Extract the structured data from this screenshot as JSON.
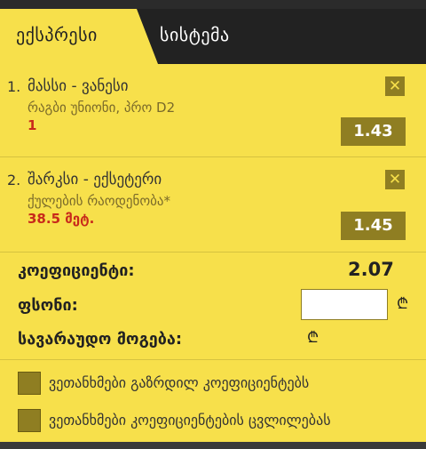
{
  "tabs": {
    "express": "ექსპრესი",
    "system": "სისტემა"
  },
  "bets": [
    {
      "index": "1.",
      "match": "მასსი - ვანესი",
      "market": "რაგბი უნიონი, პრო D2",
      "pick": "1",
      "odds": "1.43",
      "close": "✕"
    },
    {
      "index": "2.",
      "match": "შარკსი - ექსეტერი",
      "market": "ქულების რაოდენობა*",
      "pick": "38.5 მეტ.",
      "odds": "1.45",
      "close": "✕"
    }
  ],
  "summary": {
    "coef_label": "კოეფიციენტი:",
    "coef_value": "2.07",
    "stake_label": "ფსონი:",
    "stake_value": "",
    "win_label": "სავარაუდო მოგება:",
    "currency": "₾"
  },
  "checks": {
    "accept_increased": "ვეთანხმები გაზრდილ კოეფიციენტებს",
    "accept_changes": "ვეთანხმები კოეფიციენტების ცვლილებას"
  }
}
